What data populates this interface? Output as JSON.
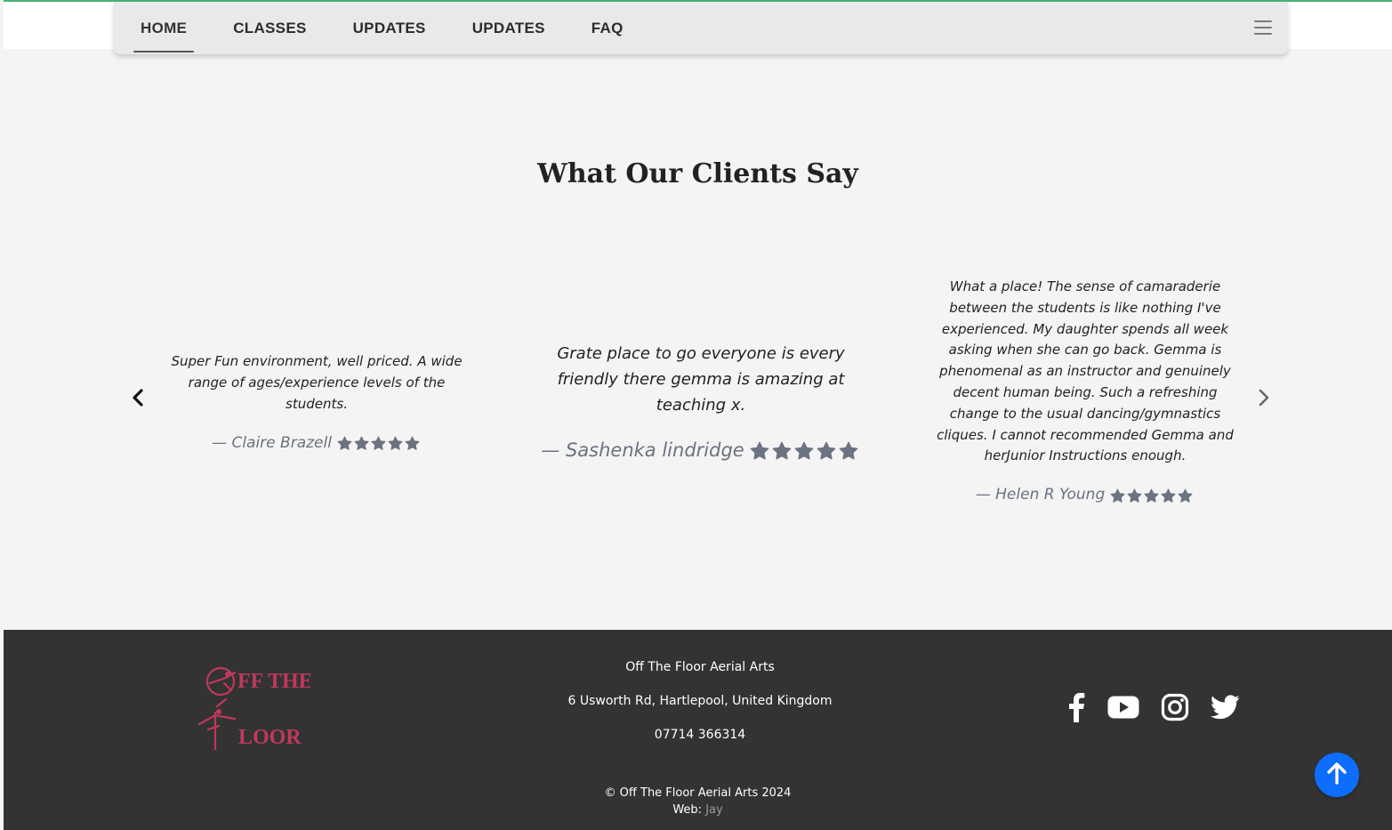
{
  "nav": {
    "items": [
      {
        "label": "HOME",
        "active": true
      },
      {
        "label": "CLASSES",
        "active": false
      },
      {
        "label": "UPDATES",
        "active": false
      },
      {
        "label": "UPDATES",
        "active": false
      },
      {
        "label": "FAQ",
        "active": false
      }
    ],
    "menu_icon": "hamburger-icon"
  },
  "testimonials": {
    "title": "What Our Clients Say",
    "prev_icon": "chevron-left-icon",
    "next_icon": "chevron-right-icon",
    "items": [
      {
        "quote": "Super Fun environment, well priced. A wide range of ages/experience levels of the students.",
        "author": "— Claire Brazell",
        "rating": 5
      },
      {
        "quote": "Grate place to go everyone is every friendly there gemma is amazing at teaching x.",
        "author": "— Sashenka lindridge",
        "rating": 5
      },
      {
        "quote": "What a place! The sense of camaraderie between the students is like nothing I've experienced. My daughter spends all week asking when she can go back. Gemma is phenomenal as an instructor and genuinely decent human being. Such a refreshing change to the usual dancing/gymnastics cliques. I cannot recommended Gemma and herJunior Instructions enough.",
        "author": "— Helen R Young",
        "rating": 5
      }
    ]
  },
  "footer": {
    "logo_text": "OFF THE FLOOR",
    "business_name": "Off The Floor Aerial Arts",
    "address": "6 Usworth Rd, Hartlepool, United Kingdom",
    "phone": "07714 366314",
    "social_icons": [
      "facebook-icon",
      "youtube-icon",
      "instagram-icon",
      "twitter-icon"
    ],
    "copyright": "© Off The Floor Aerial Arts 2024",
    "web_label": "Web:",
    "web_link": "Jay"
  },
  "colors": {
    "accent_blue": "#0d6efd",
    "footer_bg": "#333333",
    "logo_pink": "#c0395a",
    "star_gray": "#6b7280"
  },
  "back_to_top_icon": "arrow-up-icon"
}
